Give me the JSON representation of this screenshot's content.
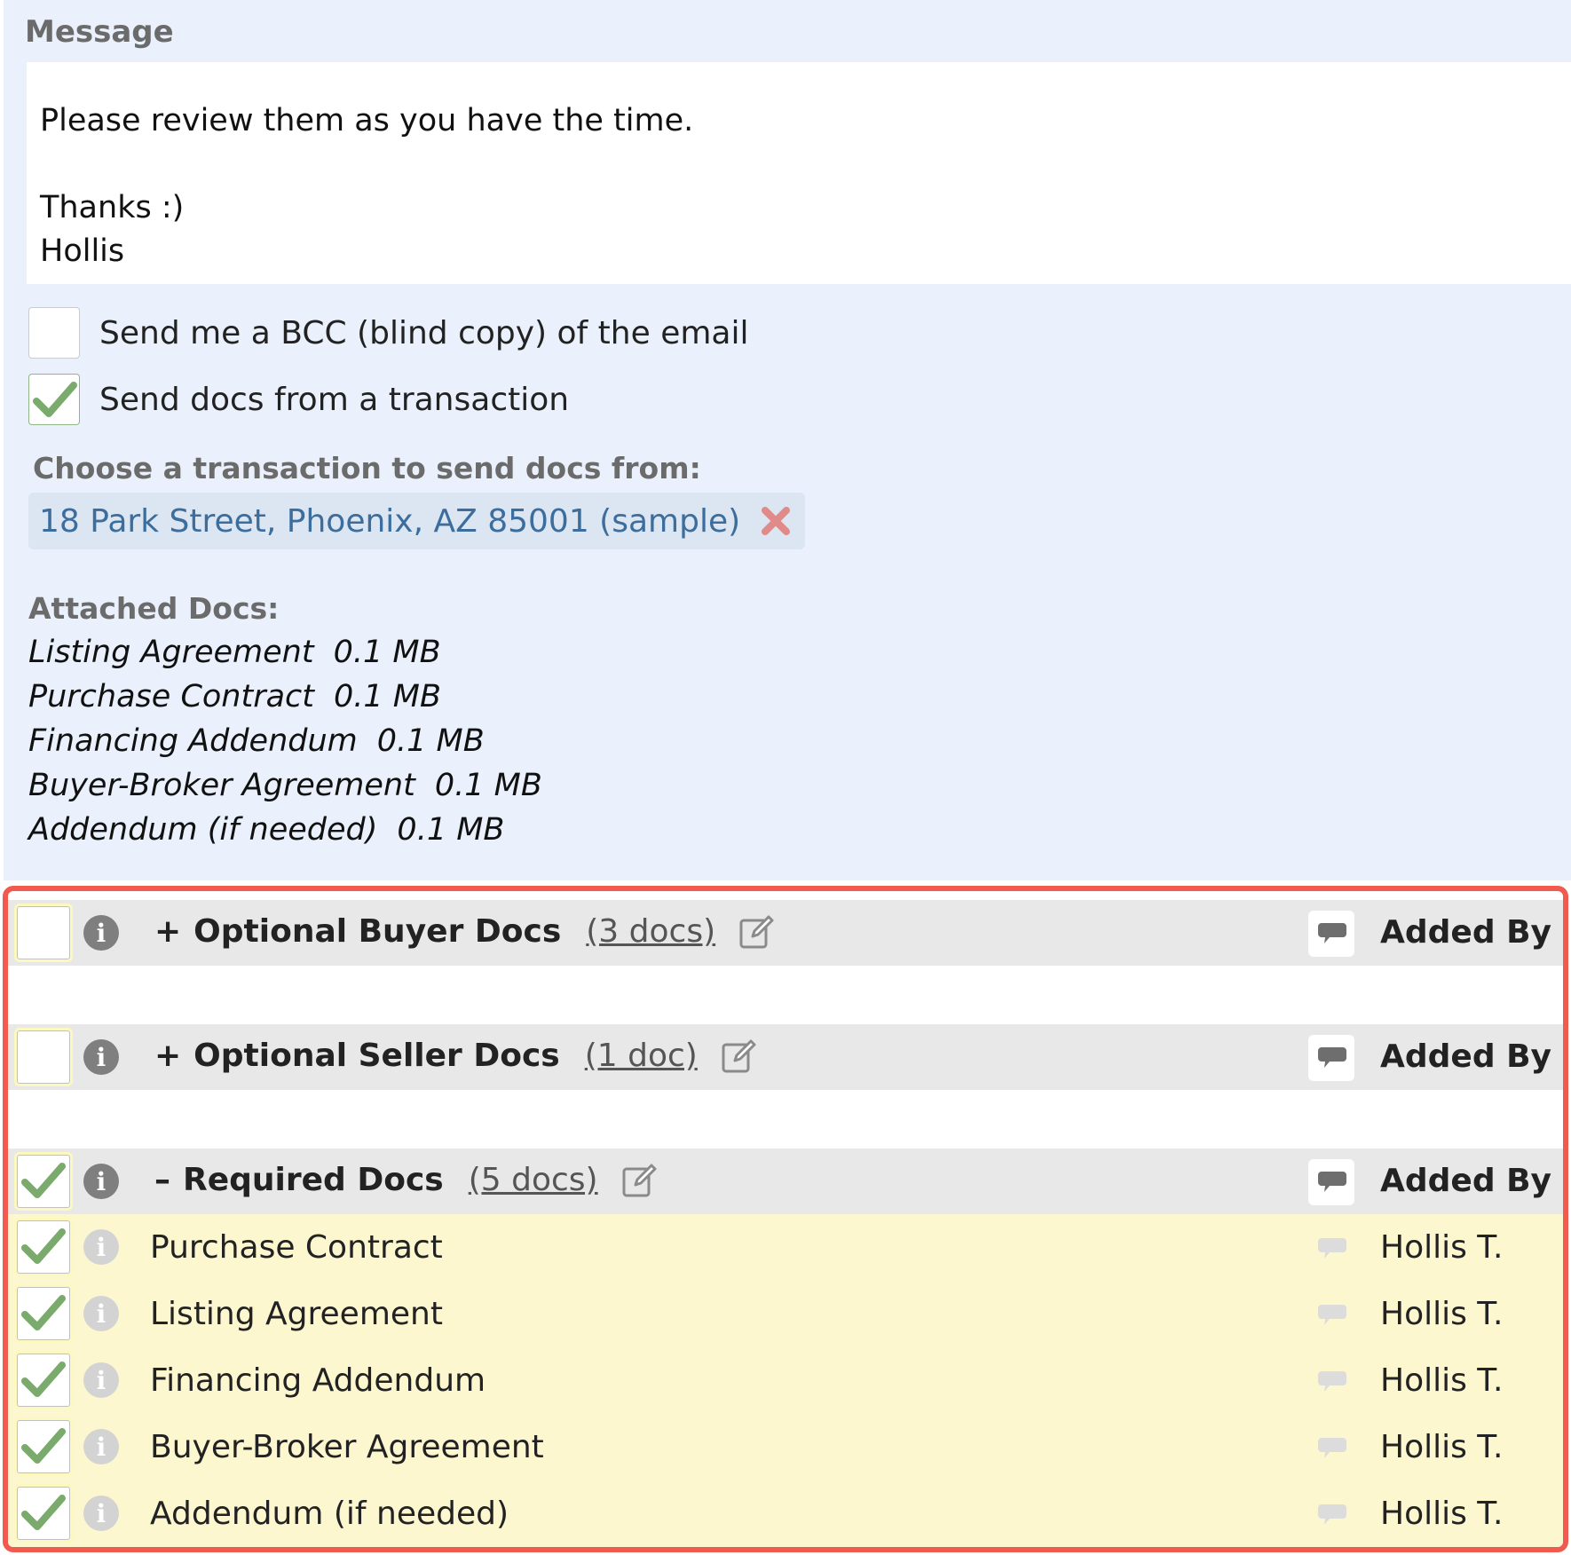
{
  "message": {
    "label": "Message",
    "lines": [
      "Please review them as you have the time.",
      "Thanks :)",
      "Hollis"
    ]
  },
  "options": {
    "bcc": {
      "label": "Send me a BCC (blind copy) of the email",
      "checked": false
    },
    "send_docs": {
      "label": "Send docs from a transaction",
      "checked": true
    }
  },
  "transaction": {
    "label": "Choose a transaction to send docs from:",
    "selected": "18 Park Street, Phoenix, AZ 85001 (sample)"
  },
  "attached": {
    "label": "Attached Docs:",
    "items": [
      {
        "name": "Listing Agreement",
        "size": "0.1 MB"
      },
      {
        "name": "Purchase Contract",
        "size": "0.1 MB"
      },
      {
        "name": "Financing Addendum",
        "size": "0.1 MB"
      },
      {
        "name": "Buyer-Broker Agreement",
        "size": "0.1 MB"
      },
      {
        "name": "Addendum (if needed)",
        "size": "0.1 MB"
      }
    ]
  },
  "doc_groups": [
    {
      "title": "Optional Buyer Docs",
      "toggle": "+",
      "count": "(3 docs)",
      "added_by_label": "Added By",
      "checked": false
    },
    {
      "title": "Optional Seller Docs",
      "toggle": "+",
      "count": "(1 doc)",
      "added_by_label": "Added By",
      "checked": false
    },
    {
      "title": "Required Docs",
      "toggle": "–",
      "count": "(5 docs)",
      "added_by_label": "Added By",
      "checked": true,
      "docs": [
        {
          "name": "Purchase Contract",
          "added_by": "Hollis T.",
          "checked": true
        },
        {
          "name": "Listing Agreement",
          "added_by": "Hollis T.",
          "checked": true
        },
        {
          "name": "Financing Addendum",
          "added_by": "Hollis T.",
          "checked": true
        },
        {
          "name": "Buyer-Broker Agreement",
          "added_by": "Hollis T.",
          "checked": true
        },
        {
          "name": "Addendum (if needed)",
          "added_by": "Hollis T.",
          "checked": true
        }
      ]
    }
  ],
  "icons": {
    "info": "info-icon",
    "edit": "edit-icon",
    "comment": "comment-icon",
    "check": "checkmark-icon",
    "remove": "close-icon"
  },
  "colors": {
    "panel_bg": "#eaf1fc",
    "highlight_border": "#f05a4f",
    "doc_row_bg": "#fdf7d0",
    "group_row_bg": "#e8e8e8",
    "check_green": "#7aaa6c",
    "link_blue": "#3c6d9c",
    "remove_red": "#e08a8a"
  }
}
